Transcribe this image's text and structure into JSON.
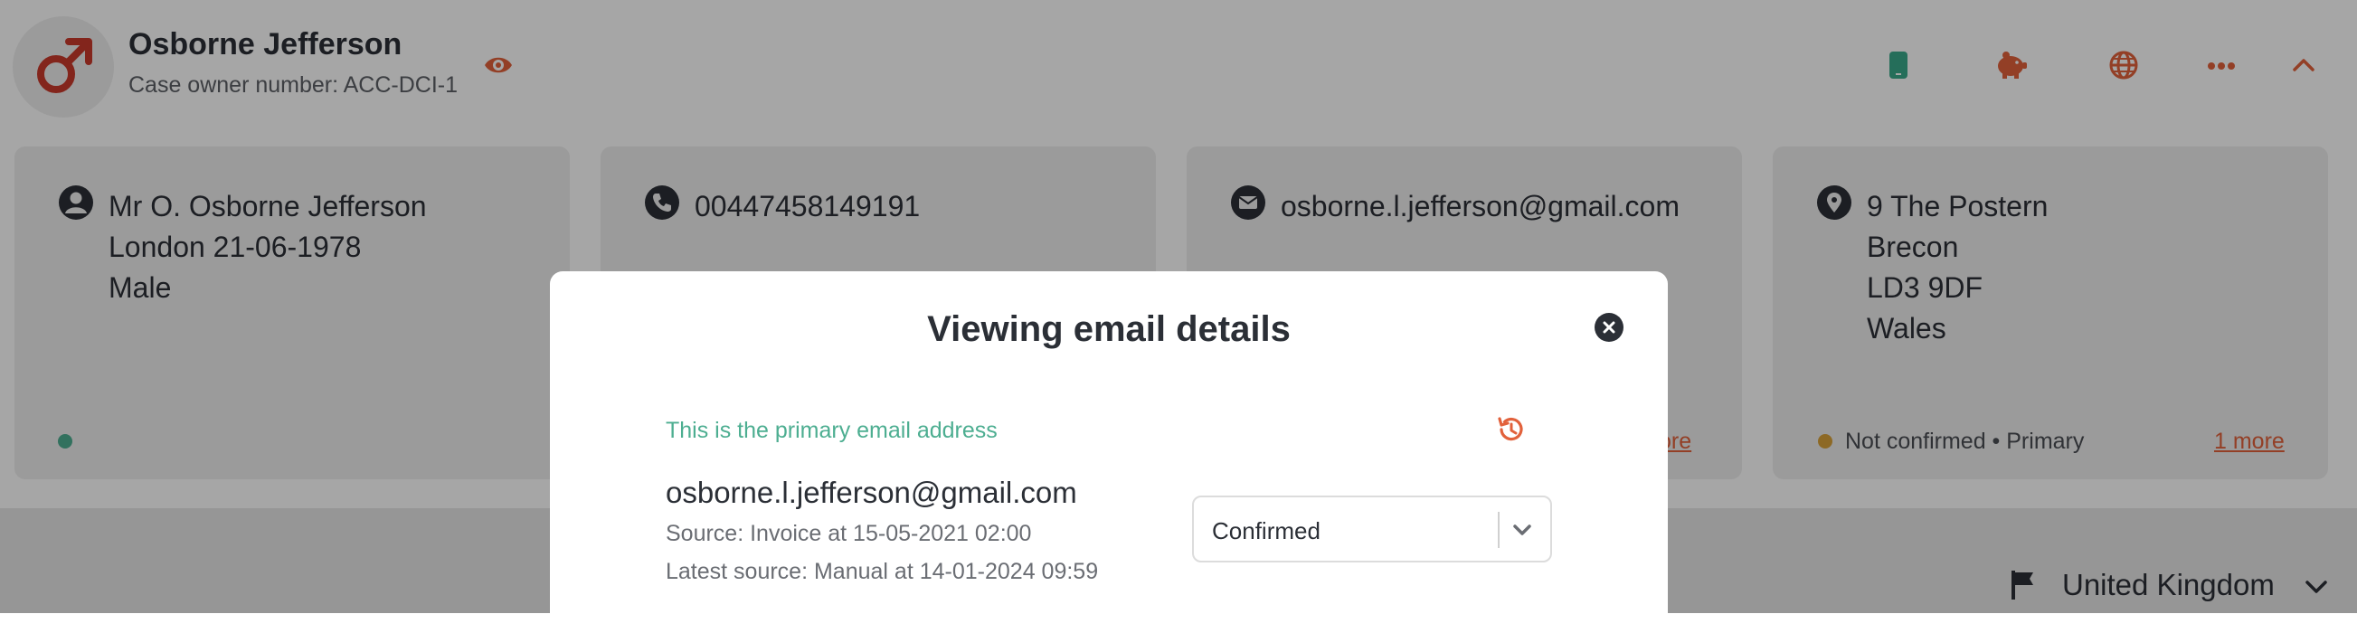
{
  "header": {
    "name": "Osborne Jefferson",
    "case_owner": "Case owner number: ACC-DCI-1",
    "icons": [
      "male-icon",
      "eye-icon",
      "mobile-icon",
      "piggy-bank-icon",
      "globe-icon",
      "more-icon",
      "chevron-up-icon"
    ]
  },
  "cards": {
    "person": {
      "lines": [
        "Mr O. Osborne Jefferson",
        "London 21-06-1978",
        "Male"
      ],
      "status_color": "#4dae91"
    },
    "phone": {
      "number": "00447458149191"
    },
    "email": {
      "address": "osborne.l.jefferson@gmail.com",
      "more_partial": "ore"
    },
    "address": {
      "lines": [
        "9 The Postern",
        "Brecon",
        "LD3 9DF",
        "Wales"
      ],
      "status": "Not confirmed • Primary",
      "more": "1 more",
      "status_color": "#d9a23a"
    }
  },
  "bottom": {
    "country": "United Kingdom"
  },
  "modal": {
    "title": "Viewing email details",
    "primary_note": "This is the primary email address",
    "email": "osborne.l.jefferson@gmail.com",
    "source": "Source: Invoice at 15-05-2021 02:00",
    "latest_source": "Latest source: Manual at 14-01-2024 09:59",
    "status_select": {
      "value": "Confirmed"
    }
  },
  "colors": {
    "accent": "#e2613b",
    "success": "#4dae91",
    "mobile": "#3aa98a",
    "warning": "#d9a23a",
    "text": "#2b2f36"
  }
}
